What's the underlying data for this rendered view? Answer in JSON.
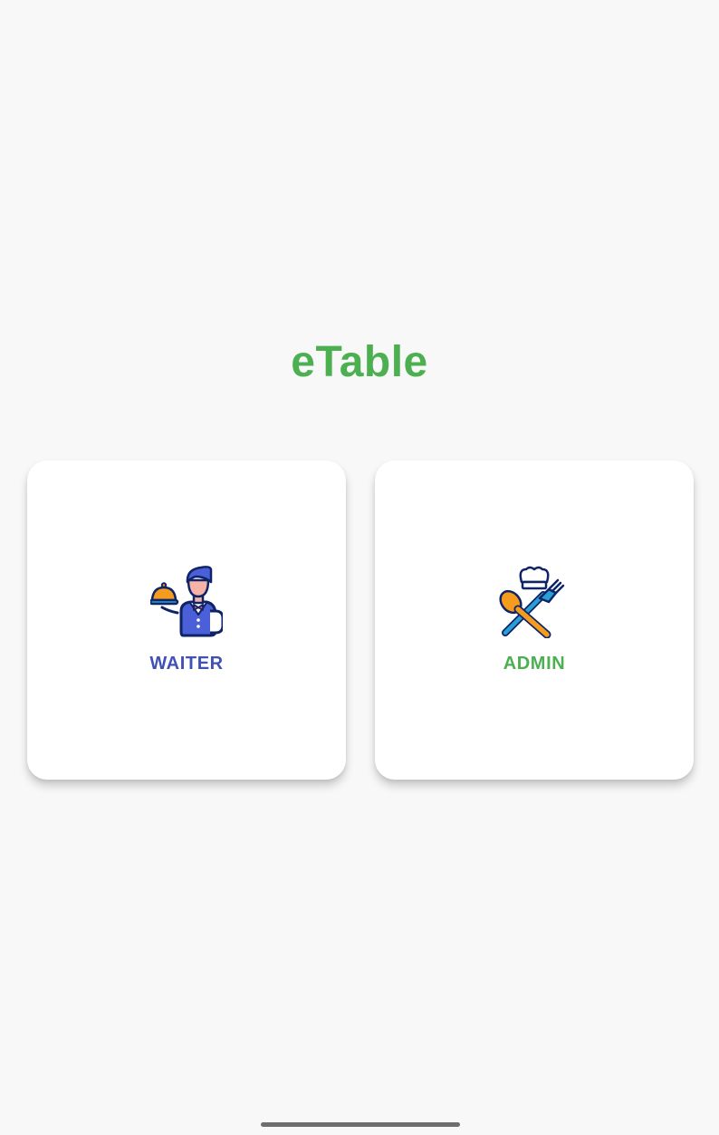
{
  "app": {
    "title": "eTable",
    "title_color": "#4caf50"
  },
  "cards": [
    {
      "id": "waiter",
      "label": "WAITER",
      "icon": "waiter-icon",
      "label_color": "#3f51b5"
    },
    {
      "id": "admin",
      "label": "ADMIN",
      "icon": "chef-utensils-icon",
      "label_color": "#4caf50"
    }
  ],
  "colors": {
    "background": "#f8f8f8",
    "card": "#ffffff",
    "icon_outline": "#0e2466",
    "icon_blue": "#4a5fd8",
    "icon_light_blue": "#7b8cf0",
    "icon_skin": "#f7b3a8",
    "icon_orange": "#f59b1e",
    "icon_teal": "#2a9fd6"
  }
}
